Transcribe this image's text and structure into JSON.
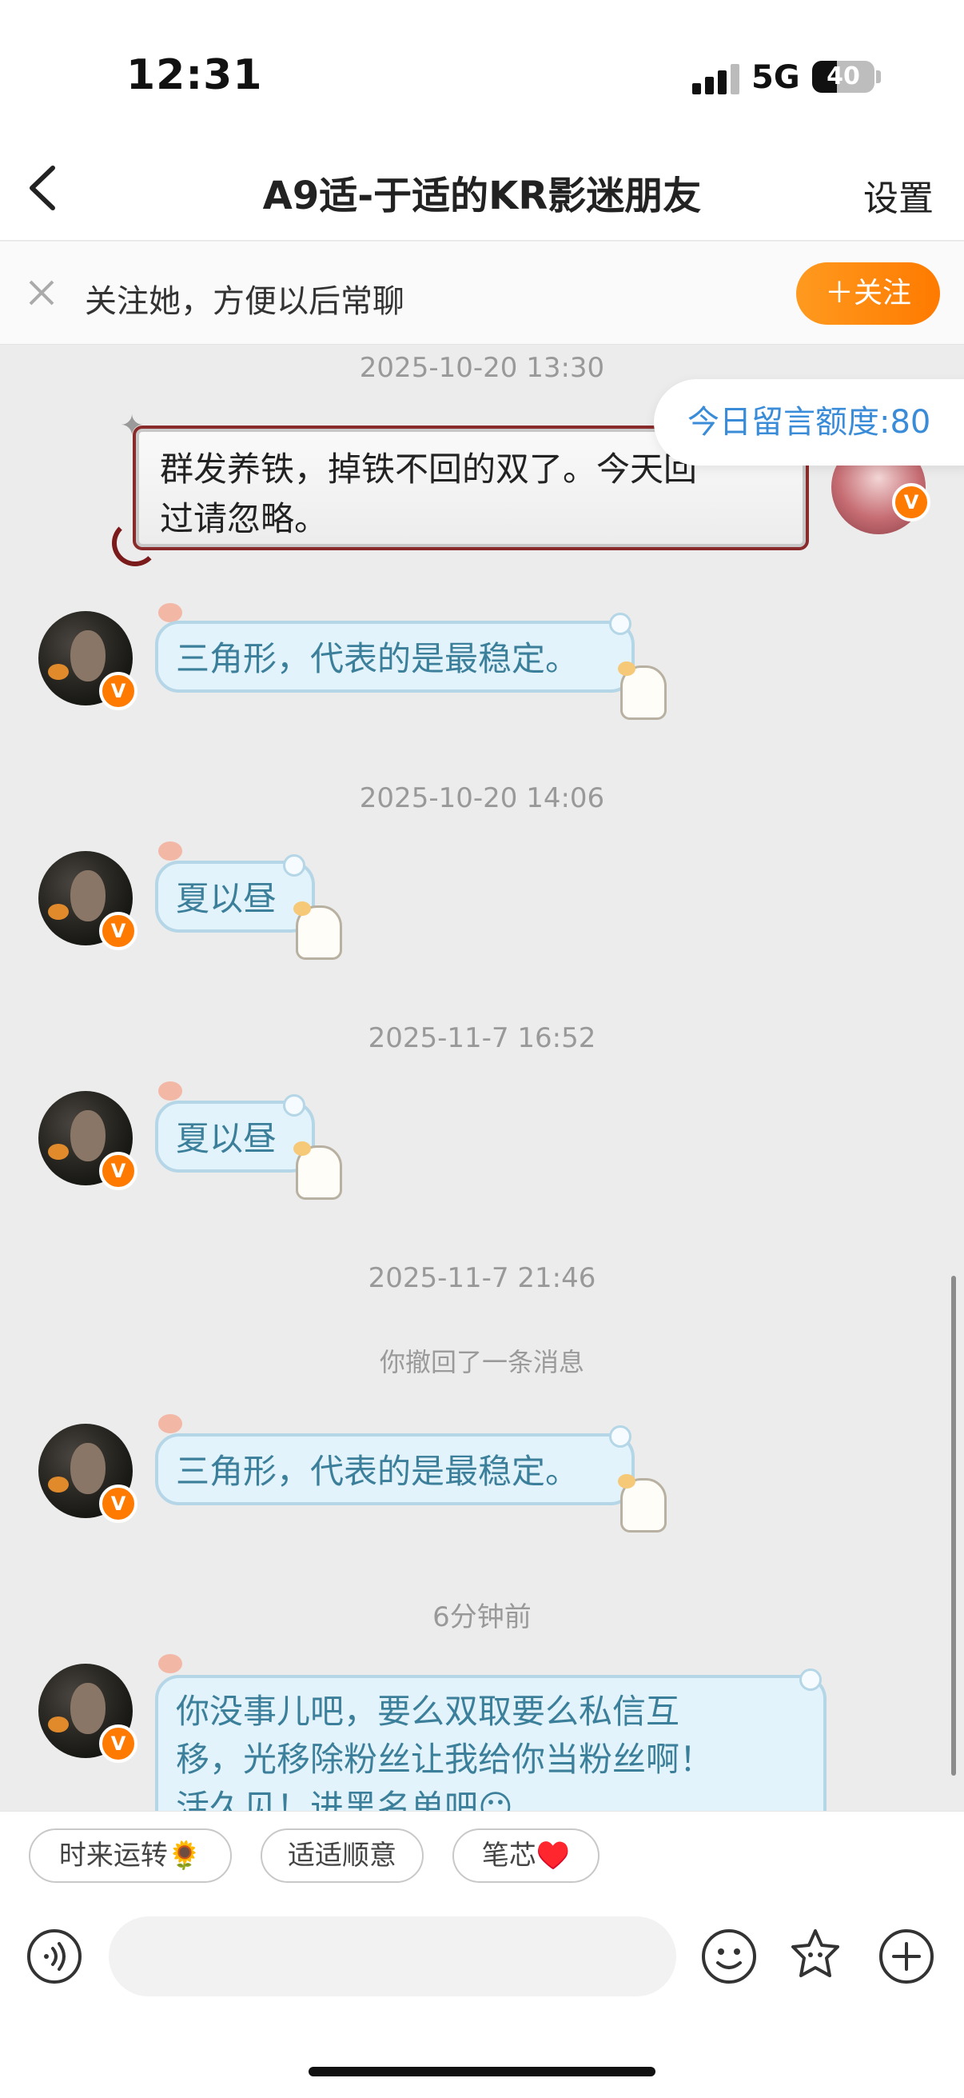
{
  "status": {
    "time": "12:31",
    "network": "5G",
    "battery": "40",
    "battery_level": 0.4
  },
  "nav": {
    "title": "A9适-于适的KR影迷朋友",
    "settings_label": "设置"
  },
  "follow_bar": {
    "text": "关注她，方便以后常聊",
    "button": "＋关注"
  },
  "quota": "今日留言额度:80",
  "messages": [
    {
      "timestamp": "2025-10-20 13:30",
      "sender": "me",
      "text_line1": "群发养铁，掉铁不回的双了。今天回",
      "text_line2": "过请忽略。"
    },
    {
      "sender": "friend",
      "text": "三角形，代表的是最稳定。"
    },
    {
      "timestamp": "2025-10-20 14:06",
      "sender": "friend",
      "text": "夏以昼"
    },
    {
      "timestamp": "2025-11-7 16:52",
      "sender": "friend",
      "text": "夏以昼"
    },
    {
      "timestamp": "2025-11-7 21:46",
      "system": "你撤回了一条消息",
      "sender": "friend",
      "text": "三角形，代表的是最稳定。"
    },
    {
      "timestamp": "6分钟前",
      "sender": "friend",
      "text_line1": "你没事儿吧，要么双取要么私信互",
      "text_line2": "移，光移除粉丝让我给你当粉丝啊！",
      "text_line3": "活久见！进黑名单吧😶"
    }
  ],
  "quick_replies": [
    "时来运转🌻",
    "适适顺意",
    "笔芯♥️"
  ],
  "icons": {
    "back": "chevron-left-icon",
    "close": "close-icon",
    "voice": "voice-icon",
    "emoji": "emoji-icon",
    "sticker": "sticker-icon",
    "add": "plus-circle-icon"
  },
  "colors": {
    "accent": "#ff7a00",
    "bubble": "#e3f3fb",
    "bubble_text": "#3b7f9a",
    "link": "#3a8cd8"
  }
}
